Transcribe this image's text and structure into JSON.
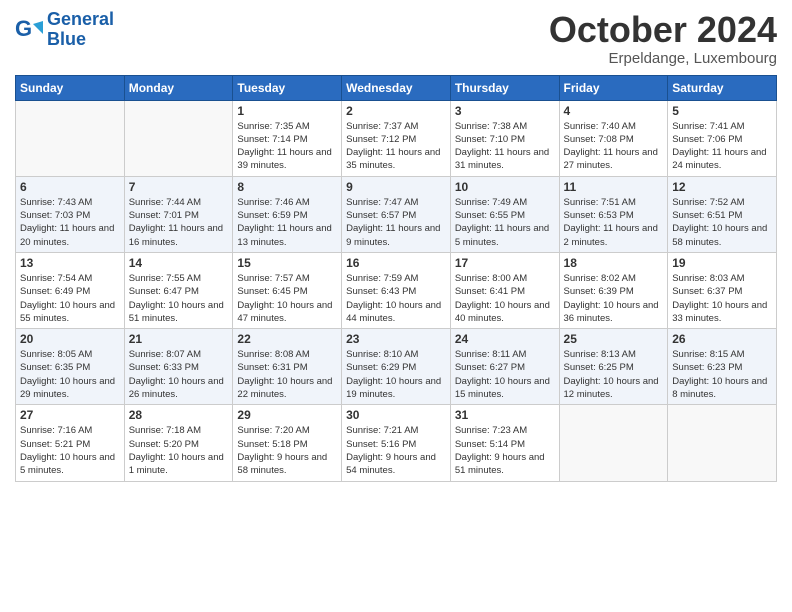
{
  "logo": {
    "line1": "General",
    "line2": "Blue"
  },
  "title": "October 2024",
  "subtitle": "Erpeldange, Luxembourg",
  "headers": [
    "Sunday",
    "Monday",
    "Tuesday",
    "Wednesday",
    "Thursday",
    "Friday",
    "Saturday"
  ],
  "weeks": [
    [
      {
        "day": "",
        "info": ""
      },
      {
        "day": "",
        "info": ""
      },
      {
        "day": "1",
        "info": "Sunrise: 7:35 AM\nSunset: 7:14 PM\nDaylight: 11 hours and 39 minutes."
      },
      {
        "day": "2",
        "info": "Sunrise: 7:37 AM\nSunset: 7:12 PM\nDaylight: 11 hours and 35 minutes."
      },
      {
        "day": "3",
        "info": "Sunrise: 7:38 AM\nSunset: 7:10 PM\nDaylight: 11 hours and 31 minutes."
      },
      {
        "day": "4",
        "info": "Sunrise: 7:40 AM\nSunset: 7:08 PM\nDaylight: 11 hours and 27 minutes."
      },
      {
        "day": "5",
        "info": "Sunrise: 7:41 AM\nSunset: 7:06 PM\nDaylight: 11 hours and 24 minutes."
      }
    ],
    [
      {
        "day": "6",
        "info": "Sunrise: 7:43 AM\nSunset: 7:03 PM\nDaylight: 11 hours and 20 minutes."
      },
      {
        "day": "7",
        "info": "Sunrise: 7:44 AM\nSunset: 7:01 PM\nDaylight: 11 hours and 16 minutes."
      },
      {
        "day": "8",
        "info": "Sunrise: 7:46 AM\nSunset: 6:59 PM\nDaylight: 11 hours and 13 minutes."
      },
      {
        "day": "9",
        "info": "Sunrise: 7:47 AM\nSunset: 6:57 PM\nDaylight: 11 hours and 9 minutes."
      },
      {
        "day": "10",
        "info": "Sunrise: 7:49 AM\nSunset: 6:55 PM\nDaylight: 11 hours and 5 minutes."
      },
      {
        "day": "11",
        "info": "Sunrise: 7:51 AM\nSunset: 6:53 PM\nDaylight: 11 hours and 2 minutes."
      },
      {
        "day": "12",
        "info": "Sunrise: 7:52 AM\nSunset: 6:51 PM\nDaylight: 10 hours and 58 minutes."
      }
    ],
    [
      {
        "day": "13",
        "info": "Sunrise: 7:54 AM\nSunset: 6:49 PM\nDaylight: 10 hours and 55 minutes."
      },
      {
        "day": "14",
        "info": "Sunrise: 7:55 AM\nSunset: 6:47 PM\nDaylight: 10 hours and 51 minutes."
      },
      {
        "day": "15",
        "info": "Sunrise: 7:57 AM\nSunset: 6:45 PM\nDaylight: 10 hours and 47 minutes."
      },
      {
        "day": "16",
        "info": "Sunrise: 7:59 AM\nSunset: 6:43 PM\nDaylight: 10 hours and 44 minutes."
      },
      {
        "day": "17",
        "info": "Sunrise: 8:00 AM\nSunset: 6:41 PM\nDaylight: 10 hours and 40 minutes."
      },
      {
        "day": "18",
        "info": "Sunrise: 8:02 AM\nSunset: 6:39 PM\nDaylight: 10 hours and 36 minutes."
      },
      {
        "day": "19",
        "info": "Sunrise: 8:03 AM\nSunset: 6:37 PM\nDaylight: 10 hours and 33 minutes."
      }
    ],
    [
      {
        "day": "20",
        "info": "Sunrise: 8:05 AM\nSunset: 6:35 PM\nDaylight: 10 hours and 29 minutes."
      },
      {
        "day": "21",
        "info": "Sunrise: 8:07 AM\nSunset: 6:33 PM\nDaylight: 10 hours and 26 minutes."
      },
      {
        "day": "22",
        "info": "Sunrise: 8:08 AM\nSunset: 6:31 PM\nDaylight: 10 hours and 22 minutes."
      },
      {
        "day": "23",
        "info": "Sunrise: 8:10 AM\nSunset: 6:29 PM\nDaylight: 10 hours and 19 minutes."
      },
      {
        "day": "24",
        "info": "Sunrise: 8:11 AM\nSunset: 6:27 PM\nDaylight: 10 hours and 15 minutes."
      },
      {
        "day": "25",
        "info": "Sunrise: 8:13 AM\nSunset: 6:25 PM\nDaylight: 10 hours and 12 minutes."
      },
      {
        "day": "26",
        "info": "Sunrise: 8:15 AM\nSunset: 6:23 PM\nDaylight: 10 hours and 8 minutes."
      }
    ],
    [
      {
        "day": "27",
        "info": "Sunrise: 7:16 AM\nSunset: 5:21 PM\nDaylight: 10 hours and 5 minutes."
      },
      {
        "day": "28",
        "info": "Sunrise: 7:18 AM\nSunset: 5:20 PM\nDaylight: 10 hours and 1 minute."
      },
      {
        "day": "29",
        "info": "Sunrise: 7:20 AM\nSunset: 5:18 PM\nDaylight: 9 hours and 58 minutes."
      },
      {
        "day": "30",
        "info": "Sunrise: 7:21 AM\nSunset: 5:16 PM\nDaylight: 9 hours and 54 minutes."
      },
      {
        "day": "31",
        "info": "Sunrise: 7:23 AM\nSunset: 5:14 PM\nDaylight: 9 hours and 51 minutes."
      },
      {
        "day": "",
        "info": ""
      },
      {
        "day": "",
        "info": ""
      }
    ]
  ]
}
